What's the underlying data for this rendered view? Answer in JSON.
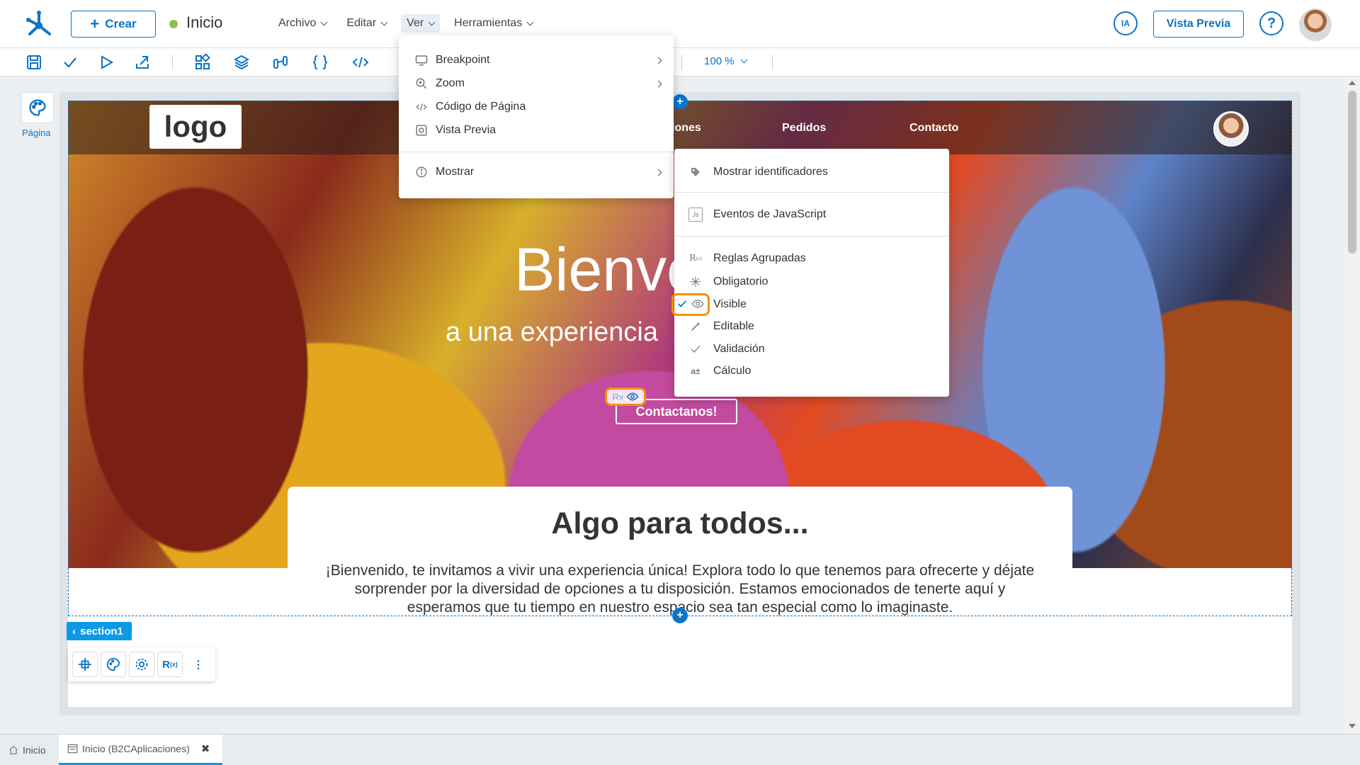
{
  "header": {
    "crear_label": "Crear",
    "page_name": "Inicio",
    "menus": [
      {
        "label": "Archivo"
      },
      {
        "label": "Editar"
      },
      {
        "label": "Ver"
      },
      {
        "label": "Herramientas"
      }
    ],
    "ia_label": "IA",
    "preview_label": "Vista Previa",
    "help_label": "?"
  },
  "toolbar": {
    "icons": [
      "save-icon",
      "check-icon",
      "play-icon",
      "export-icon",
      "components-icon",
      "layers-icon",
      "data-flow-icon",
      "braces-icon",
      "code-icon"
    ],
    "zoom": "100 %"
  },
  "left_panel": {
    "pagina_label": "Página"
  },
  "ver_menu": {
    "items": [
      {
        "label": "Breakpoint",
        "icon": "monitor-icon",
        "has_submenu": true
      },
      {
        "label": "Zoom",
        "icon": "zoom-icon",
        "has_submenu": true
      },
      {
        "label": "Código de Página",
        "icon": "code-icon",
        "has_submenu": false
      },
      {
        "label": "Vista Previa",
        "icon": "preview-icon",
        "has_submenu": false
      },
      {
        "label": "Mostrar",
        "icon": "info-icon",
        "has_submenu": true
      }
    ]
  },
  "mostrar_submenu": {
    "items": [
      {
        "label": "Mostrar identificadores",
        "icon": "tag-icon"
      },
      {
        "label": "Eventos de JavaScript",
        "icon": "js-icon"
      },
      {
        "label": "Reglas Agrupadas",
        "icon": "rules-icon"
      },
      {
        "label": "Obligatorio",
        "icon": "asterisk-icon"
      },
      {
        "label": "Visible",
        "icon": "eye-icon",
        "checked": true
      },
      {
        "label": "Editable",
        "icon": "pencil-icon"
      },
      {
        "label": "Validación",
        "icon": "check-icon"
      },
      {
        "label": "Cálculo",
        "icon": "calculator-icon"
      }
    ]
  },
  "site": {
    "logo_text": "logo",
    "nav": [
      "iones",
      "Pedidos",
      "Contacto"
    ],
    "hero_title": "Bienve",
    "hero_subtitle": "a una experiencia",
    "contact_button": "Contactanos!",
    "rx_label": "Rx",
    "card_title": "Algo para todos...",
    "card_text": "¡Bienvenido, te invitamos a vivir una experiencia única! Explora todo lo que tenemos para ofrecerte y déjate sorprender por la diversidad de opciones a tu disposición. Estamos emocionados de tenerte aquí y esperamos que tu tiempo en nuestro espacio sea tan especial como lo imaginaste."
  },
  "section": {
    "tag_label": "section1",
    "tools": [
      "move-icon",
      "palette-icon",
      "settings-icon",
      "rules-icon",
      "more-icon"
    ]
  },
  "bottom_tabs": [
    {
      "label": "Inicio",
      "icon": "home-icon",
      "active": false
    },
    {
      "label": "Inicio (B2CAplicaciones)",
      "icon": "page-icon",
      "active": true,
      "close": "✖"
    }
  ],
  "colors": {
    "accent": "#0b74c8",
    "highlight": "#f39200",
    "status_dot": "#8bc34a",
    "section_tag": "#0b9ae6"
  }
}
